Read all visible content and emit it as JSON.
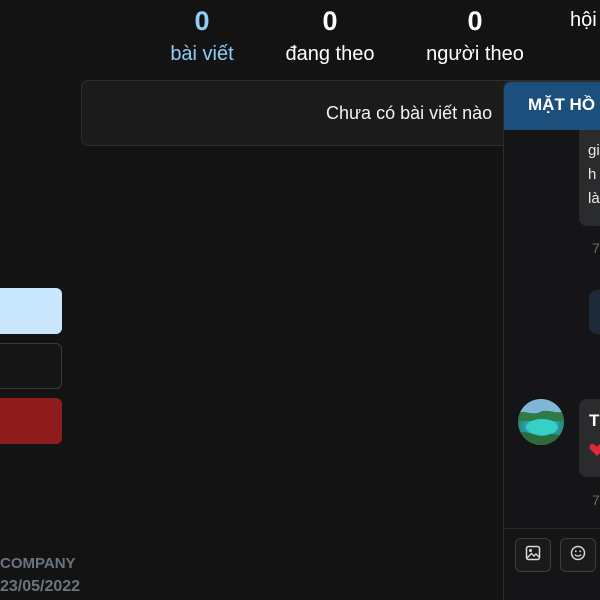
{
  "stats": [
    {
      "count": "0",
      "label": "bài viết"
    },
    {
      "count": "0",
      "label": "đang theo"
    },
    {
      "count": "0",
      "label": "người theo"
    },
    {
      "count": "",
      "label": "hội"
    }
  ],
  "posts": {
    "empty_text": "Chưa có bài viết nào"
  },
  "footer": {
    "company": "COMPANY",
    "date": "23/05/2022"
  },
  "chat": {
    "title": "MẶT HỒ",
    "message1_lines": [
      "gi",
      "h",
      "là"
    ],
    "message1_time": "7",
    "message2_name": "T",
    "message2_time": "7",
    "tools": [
      "image-icon",
      "emoji-icon"
    ]
  },
  "colors": {
    "accent": "#8ecdf8",
    "header": "#1d4f7d",
    "danger": "#8f1d1d",
    "light_button": "#c9e6ff"
  }
}
